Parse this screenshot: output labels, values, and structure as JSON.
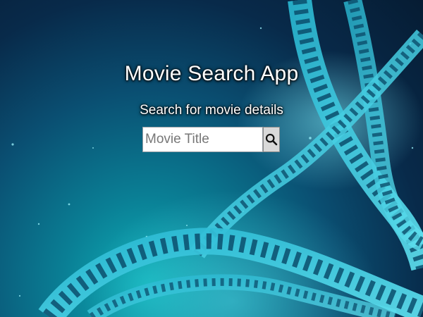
{
  "app": {
    "title": "Movie Search App",
    "subtitle": "Search for movie details"
  },
  "search": {
    "placeholder": "Movie Title",
    "value": "",
    "button_icon": "search-icon"
  },
  "background": {
    "decoration": "film-strip-reel",
    "accent_color": "#3fd4e6",
    "base_color": "#061c33"
  }
}
